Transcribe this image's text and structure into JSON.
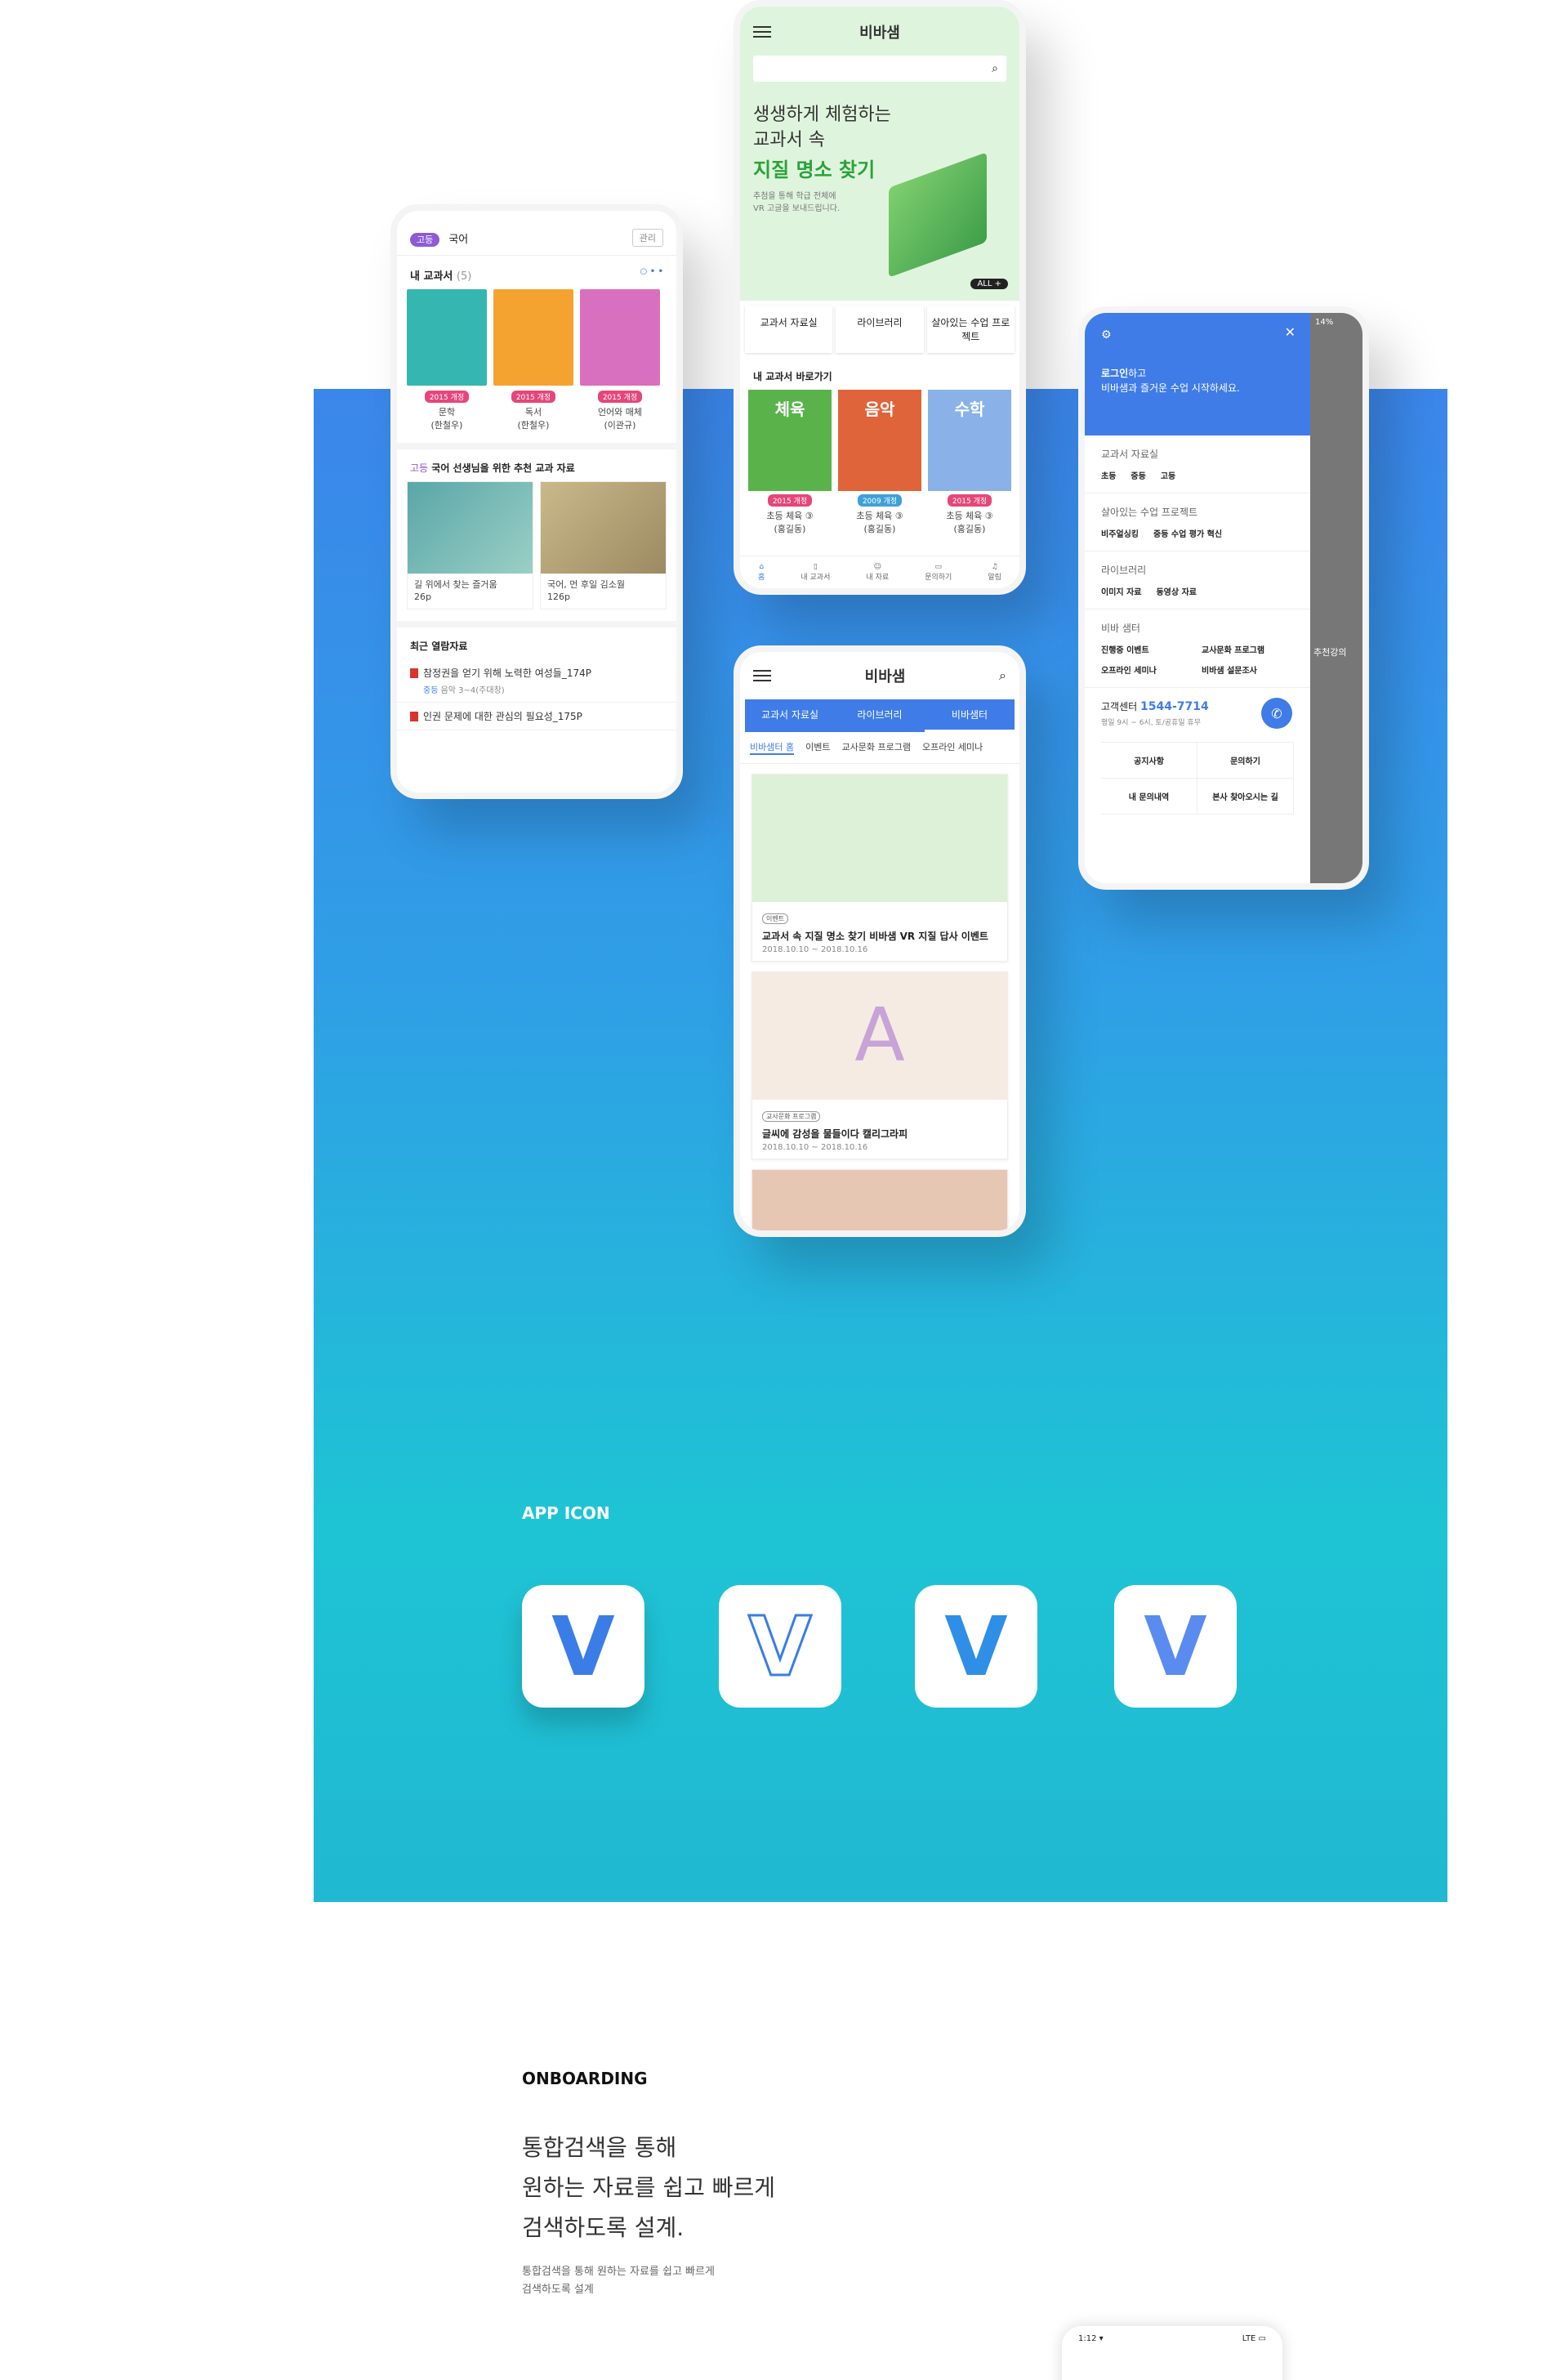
{
  "phone1": {
    "grade_badge": "고등",
    "subject": "국어",
    "manage_label": "관리",
    "my_textbooks_title": "내 교과서",
    "my_textbooks_count": "(5)",
    "books": [
      {
        "badge": "2015 개정",
        "title": "문학",
        "author": "(한철우)",
        "color": "#36b6b0"
      },
      {
        "badge": "2015 개정",
        "title": "독서",
        "author": "(한철우)",
        "color": "#f5a330"
      },
      {
        "badge": "2015 개정",
        "title": "언어와 매체",
        "author": "(이관규)",
        "color": "#d86fbf"
      }
    ],
    "rec_grade": "고등",
    "rec_title": "국어 선생님을 위한 추천 교과 자료",
    "rec_items": [
      {
        "caption": "길 위에서 찾는 즐거움",
        "pages": "26p"
      },
      {
        "caption": "국어, 먼 후일 김소월",
        "pages": "126p"
      }
    ],
    "recent_title": "최근 열람자료",
    "recent_items": [
      {
        "text": "참정권을 얻기 위해 노력한 여성들_174P",
        "meta_grade": "중등",
        "meta": "음악 3~4(주대창)"
      },
      {
        "text": "인권 문제에 대한 관심의 필요성_175P"
      }
    ]
  },
  "phone2": {
    "logo": "비바샘",
    "hero_line1": "생생하게 체험하는",
    "hero_line2": "교과서 속",
    "hero_line3": "지질 명소 찾기",
    "hero_sub1": "추첨을 통해 학급 전체에",
    "hero_sub2": "VR 고글을 보내드립니다.",
    "all_label": "ALL +",
    "tabs": [
      "교과서 자료실",
      "라이브러리",
      "살아있는 수업 프로젝트"
    ],
    "shortcut_title": "내 교과서 바로가기",
    "books": [
      {
        "cover": "체육",
        "badge": "2015 개정",
        "title": "초등 체육 ③",
        "author": "(홍길동)",
        "color": "#5ab34a"
      },
      {
        "cover": "음악",
        "badge": "2009 개정",
        "title": "초등 체육 ③",
        "author": "(홍길동)",
        "color": "#e0643a"
      },
      {
        "cover": "수학",
        "badge": "2015 개정",
        "title": "초등 체육 ③",
        "author": "(홍길동)",
        "color": "#8ab2e8"
      }
    ],
    "nav": [
      "홈",
      "내 교과서",
      "내 자료",
      "문의하기",
      "알림"
    ]
  },
  "phone3": {
    "logo": "비바샘",
    "tabs": [
      "교과서 자료실",
      "라이브러리",
      "비바샘터"
    ],
    "subtabs": [
      "비바샘터 홈",
      "이벤트",
      "교사문화 프로그램",
      "오프라인 세미나"
    ],
    "cards": [
      {
        "tag": "이벤트",
        "title": "교과서 속 지질 명소 찾기 비바샘 VR 지질 답사 이벤트",
        "date": "2018.10.10 ~ 2018.10.16",
        "bg": "#dcf1d8"
      },
      {
        "tag": "교사문화 프로그램",
        "title": "글씨에 감성을 물들이다 캘리그라피",
        "date": "2018.10.10 ~ 2018.10.16",
        "bg": "#f6ebe3"
      }
    ]
  },
  "phone4": {
    "login_label": "로그인",
    "login_suffix": "하고",
    "login_sub": "비바샘과 즐거운 수업 시작하세요.",
    "sections": [
      {
        "title": "교과서 자료실",
        "items": [
          "초등",
          "중등",
          "고등"
        ]
      },
      {
        "title": "살아있는 수업 프로젝트",
        "items": [
          "비주얼싱킹",
          "중등 수업 평가 혁신"
        ]
      },
      {
        "title": "라이브러리",
        "items": [
          "이미지 자료",
          "동영상 자료"
        ]
      }
    ],
    "center_title": "비바 샘터",
    "center_items": [
      "진행중 이벤트",
      "교사문화 프로그램",
      "오프라인 세미나",
      "비바샘 설문조사"
    ],
    "cs_label": "고객센터",
    "cs_number": "1544-7714",
    "cs_hours": "평일 9시 ~ 6시, 토/공휴일 휴무",
    "footer_links": [
      "공지사항",
      "문의하기",
      "내 문의내역",
      "본사 찾아오시는 길"
    ],
    "status_percent": "14%",
    "side_text": "추천강의"
  },
  "app_icon": {
    "heading": "APP ICON",
    "icons": [
      "V",
      "V",
      "V",
      "V"
    ]
  },
  "onboarding": {
    "heading": "ONBOARDING",
    "line1": "통합검색을 통해",
    "line2": "원하는 자료를 쉽고 빠르게",
    "line3": "검색하도록 설계.",
    "small1": "통합검색을 통해 원하는 자료를 쉽고 빠르게",
    "small2": "검색하도록 설계",
    "peek_time": "1:12 ▾",
    "peek_status": "LTE ▭"
  }
}
